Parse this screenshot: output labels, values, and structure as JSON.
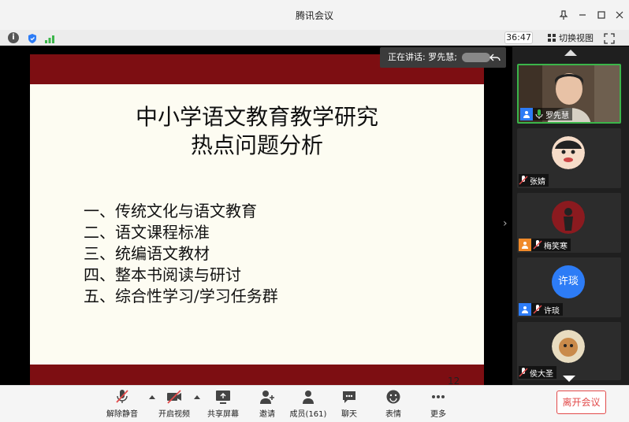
{
  "window": {
    "title": "腾讯会议"
  },
  "toolbar": {
    "timer": "36:47",
    "switch_view_label": "切换视图",
    "icons": [
      "info-icon",
      "shield-icon",
      "signal-icon",
      "grid-icon",
      "fullscreen-icon"
    ]
  },
  "slide": {
    "title_line1": "中小学语文教育教学研究",
    "title_line2": "热点问题分析",
    "items": [
      "一、传统文化与语文教育",
      "二、语文课程标准",
      "三、统编语文教材",
      "四、整本书阅读与研讨",
      "五、综合性学习/学习任务群"
    ],
    "page_number": "12",
    "band_color": "#7d0e12"
  },
  "speaking": {
    "text": "正在讲话: 罗先慧;"
  },
  "participants": [
    {
      "name": "罗先慧",
      "active": true
    },
    {
      "name": "张婧"
    },
    {
      "name": "梅笑寒"
    },
    {
      "name": "许琰",
      "avatar_text": "许琰"
    },
    {
      "name": "侯大圣"
    }
  ],
  "bottombar": {
    "buttons": [
      {
        "label": "解除静音",
        "icon": "mic-muted-icon"
      },
      {
        "label": "开启视频",
        "icon": "video-off-icon"
      },
      {
        "label": "共享屏幕",
        "icon": "share-screen-icon"
      },
      {
        "label": "邀请",
        "icon": "invite-icon"
      },
      {
        "label": "成员(161)",
        "icon": "members-icon"
      },
      {
        "label": "聊天",
        "icon": "chat-icon"
      },
      {
        "label": "表情",
        "icon": "emoji-icon"
      },
      {
        "label": "更多",
        "icon": "more-icon"
      }
    ],
    "leave_label": "离开会议",
    "leave_color": "#e24a4a"
  }
}
